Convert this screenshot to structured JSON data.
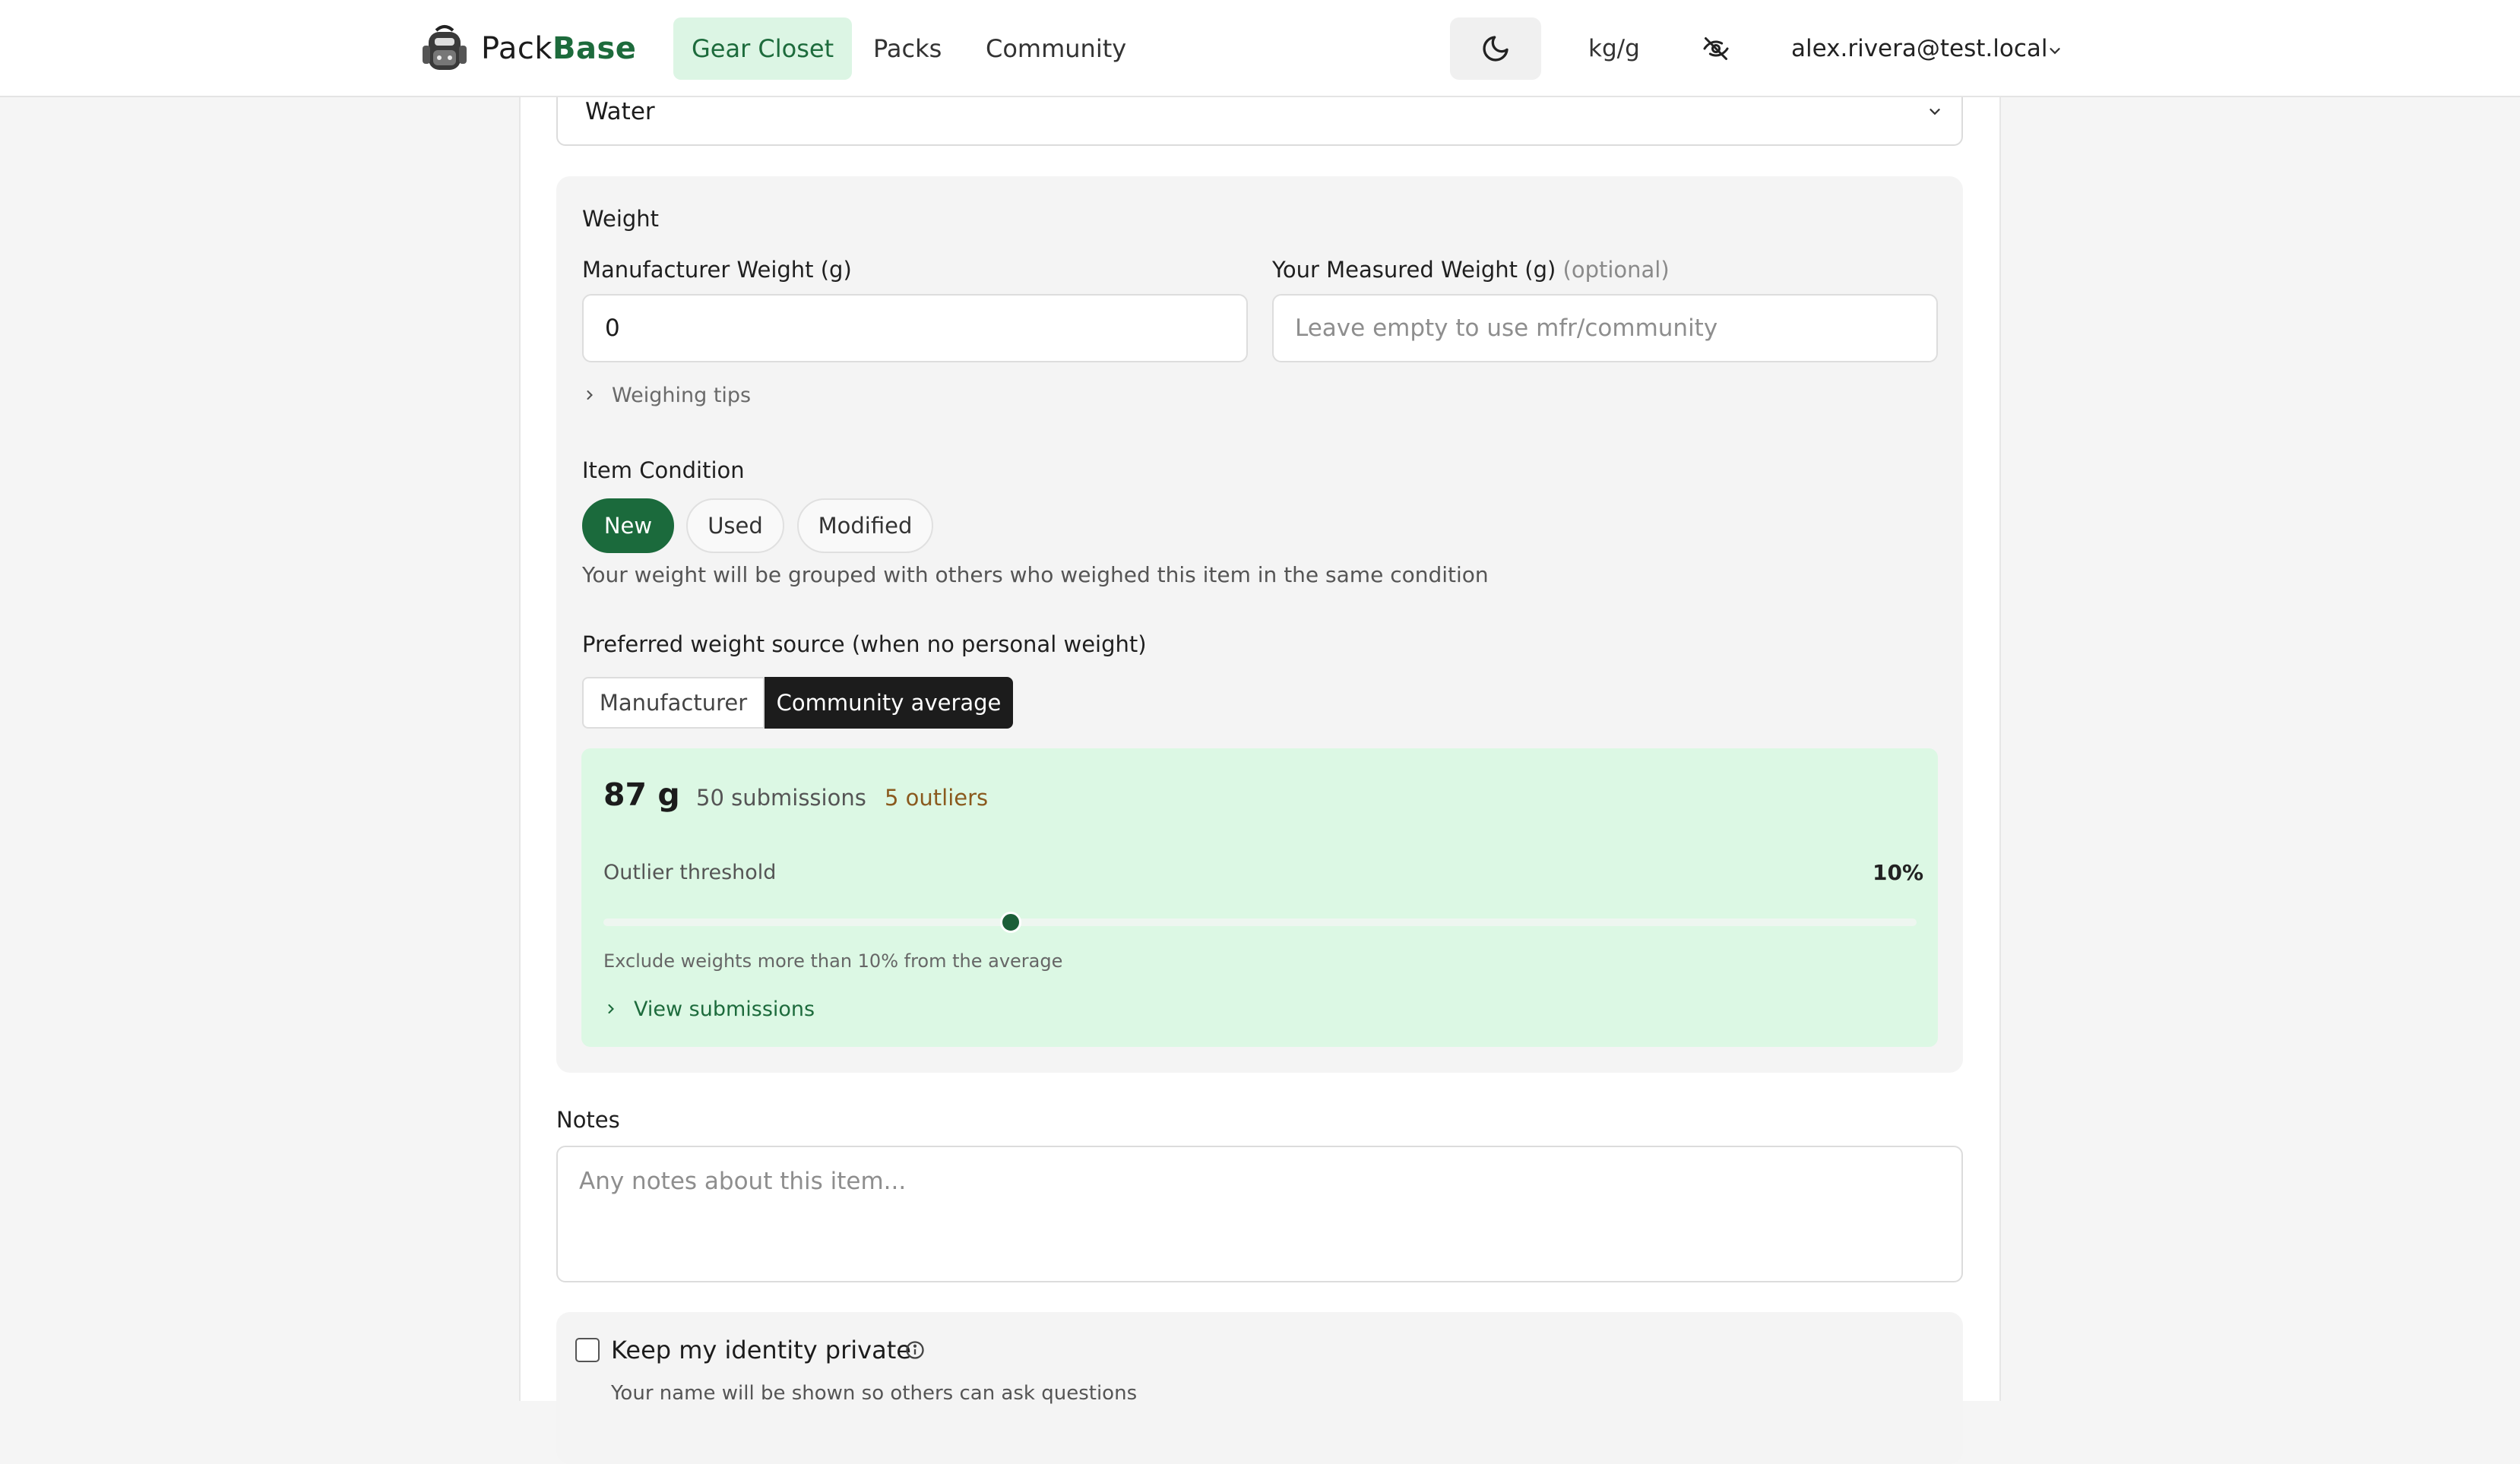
{
  "nav": {
    "brand_prefix": "Pack",
    "brand_suffix": "Base",
    "links": [
      "Gear Closet",
      "Packs",
      "Community"
    ],
    "active_link": "Gear Closet",
    "unit_toggle": "kg/g",
    "user_email": "alex.rivera@test.local"
  },
  "form": {
    "category_value": "Water",
    "weight_section": {
      "title": "Weight",
      "manufacturer_label": "Manufacturer Weight (g)",
      "manufacturer_value": "0",
      "measured_label": "Your Measured Weight (g)",
      "measured_optional": "(optional)",
      "measured_placeholder": "Leave empty to use mfr/community",
      "weighing_tips": "Weighing tips",
      "condition_label": "Item Condition",
      "conditions": [
        "New",
        "Used",
        "Modified"
      ],
      "selected_condition": "New",
      "condition_hint": "Your weight will be grouped with others who weighed this item in the same condition",
      "source_label": "Preferred weight source (when no personal weight)",
      "sources": [
        "Manufacturer",
        "Community average"
      ],
      "selected_source": "Community average"
    },
    "community": {
      "average_weight": "87 g",
      "submissions": "50 submissions",
      "outliers": "5 outliers",
      "threshold_label": "Outlier threshold",
      "threshold_value": "10%",
      "threshold_fraction": 0.31,
      "threshold_hint": "Exclude weights more than 10% from the average",
      "view_submissions": "View submissions"
    },
    "notes_label": "Notes",
    "notes_placeholder": "Any notes about this item...",
    "privacy_label": "Keep my identity private",
    "privacy_hint": "Your name will be shown so others can ask questions",
    "privacy_checked": false
  },
  "colors": {
    "brand_green": "#1d6b3c",
    "active_nav_bg": "#dcf5e4",
    "community_bg": "#dcf8e4",
    "outlier_text": "#8a5a1e"
  }
}
